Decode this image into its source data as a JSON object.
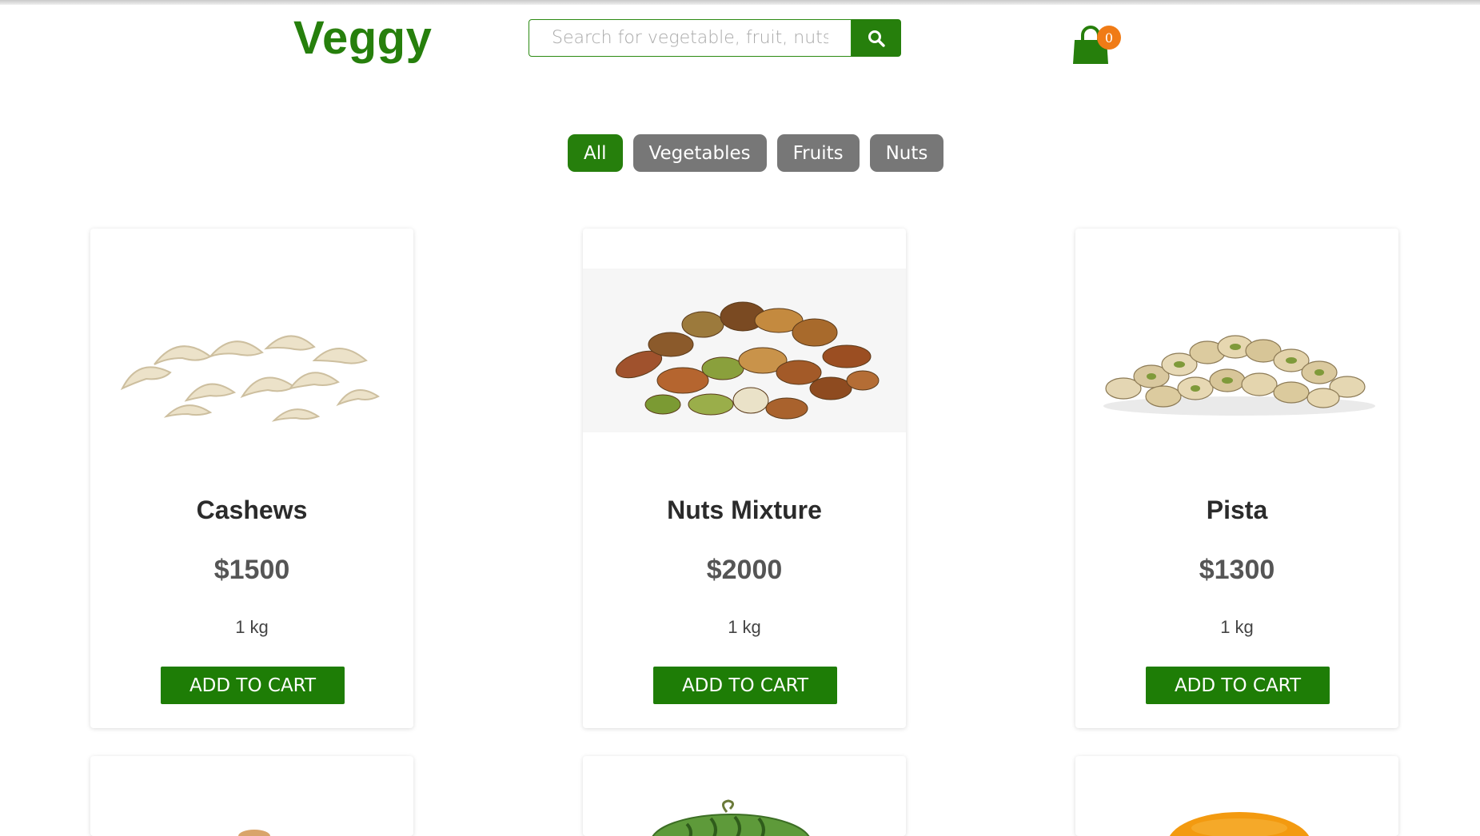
{
  "brand": {
    "name": "Veggy",
    "accent": "#267f0c"
  },
  "search": {
    "placeholder": "Search for vegetable, fruit, nuts",
    "value": "",
    "icon": "search-icon"
  },
  "cart": {
    "count": "0",
    "icon": "shopping-bag-icon",
    "badge_color": "#f07b16"
  },
  "filters": [
    {
      "label": "All",
      "active": true
    },
    {
      "label": "Vegetables",
      "active": false
    },
    {
      "label": "Fruits",
      "active": false
    },
    {
      "label": "Nuts",
      "active": false
    }
  ],
  "products": [
    {
      "name": "Cashews",
      "price": "$1500",
      "unit": "1 kg",
      "button": "ADD TO CART"
    },
    {
      "name": "Nuts Mixture",
      "price": "$2000",
      "unit": "1 kg",
      "button": "ADD TO CART"
    },
    {
      "name": "Pista",
      "price": "$1300",
      "unit": "1 kg",
      "button": "ADD TO CART"
    }
  ]
}
